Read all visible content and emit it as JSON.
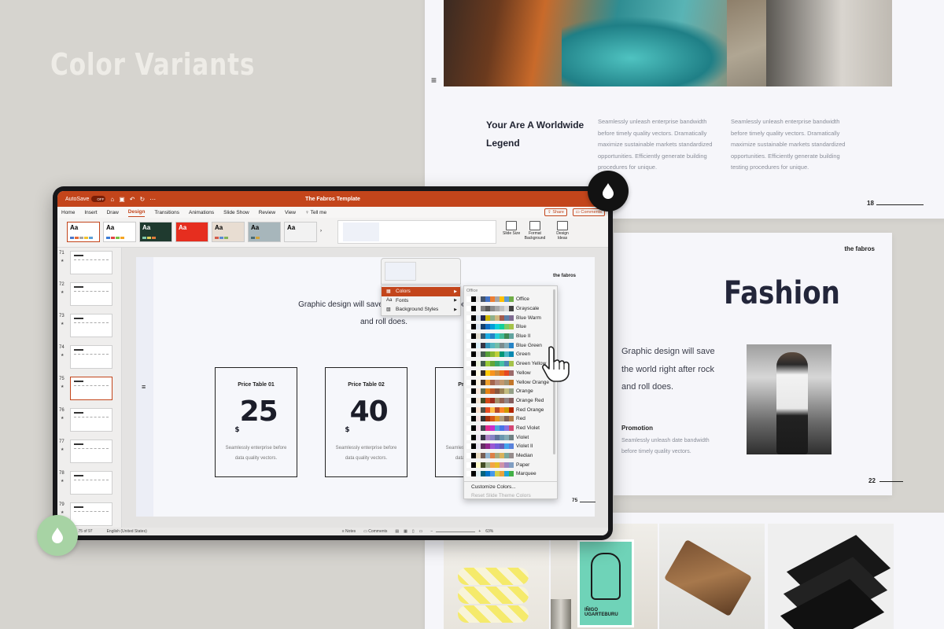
{
  "headline": "Color Variants",
  "slide_a": {
    "title": "Your Are A Worldwide Legend",
    "para1": "Seamlessly unleash enterprise bandwidth before timely  quality vectors. Dramatically maximize sustainable markets standardized opportunities. Efficiently generate building procedures for unique.",
    "para2": "Seamlessly unleash enterprise bandwidth before timely  quality vectors. Dramatically maximize sustainable markets standardized opportunities. Efficiently generate building testing procedures for unique.",
    "page": "18"
  },
  "slide_b": {
    "brand": "the fabros",
    "title": "Fashion",
    "body": "Graphic design will save the world right after rock and roll does.",
    "promo_title": "Promotion",
    "promo_text": "Seamlessly unleash date bandwidth before timely quality vectors.",
    "page": "22"
  },
  "slide_c": {
    "poster_name": "IÑIGO UGARTEBURU"
  },
  "app": {
    "autosave_label": "AutoSave",
    "autosave_state": "OFF",
    "doc_title": "The Fabros Template",
    "tabs": [
      "Home",
      "Insert",
      "Draw",
      "Design",
      "Transitions",
      "Animations",
      "Slide Show",
      "Review",
      "View",
      "Tell me"
    ],
    "active_tab": "Design",
    "share": "Share",
    "comments": "Comments",
    "theme_label": "Aa",
    "ribbon_buttons": [
      "Slide Size",
      "Format Background",
      "Design Ideas"
    ],
    "thumbs": [
      "71",
      "72",
      "73",
      "74",
      "75",
      "76",
      "77",
      "78",
      "79"
    ],
    "selected_thumb": "75",
    "status": {
      "slide_pos": "Slide 75 of 97",
      "language": "English (United States)",
      "notes": "Notes",
      "comments": "Comments",
      "zoom": "63%"
    }
  },
  "slide": {
    "brand": "the fabros",
    "head": "Graphic design will save the world right after rock and roll does.",
    "tables": [
      {
        "title": "Price Table 01",
        "currency": "$",
        "price": "25",
        "desc": "Seamlessly enterprise before data quality vectors."
      },
      {
        "title": "Price Table 02",
        "currency": "$",
        "price": "40",
        "desc": "Seamlessly enterprise before data quality vectors."
      },
      {
        "title": "Price Table 03",
        "currency": "$",
        "price": "",
        "desc": "Seamlessly enterprise before data quality vectors."
      }
    ],
    "page": "75"
  },
  "variant_menu": [
    {
      "label": "Colors",
      "icon": "▦"
    },
    {
      "label": "Fonts",
      "icon": "Aa"
    },
    {
      "label": "Background Styles",
      "icon": "▧"
    }
  ],
  "colors_menu": {
    "header": "Office",
    "items": [
      "Office",
      "Grayscale",
      "Blue Warm",
      "Blue",
      "Blue II",
      "Blue Green",
      "Green",
      "Green Yellow",
      "Yellow",
      "Yellow Orange",
      "Orange",
      "Orange Red",
      "Red Orange",
      "Red",
      "Red Violet",
      "Violet",
      "Violet II",
      "Median",
      "Paper",
      "Marquee"
    ],
    "customize": "Customize Colors...",
    "reset": "Reset Slide Theme Colors"
  },
  "accent_color": "#c3451b"
}
